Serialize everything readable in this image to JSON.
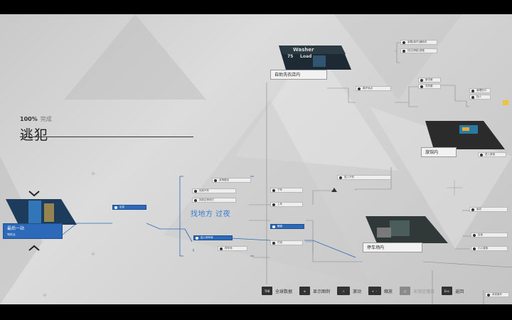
{
  "header": {
    "progress_pct": "100%",
    "progress_label": "完成",
    "chapter_title": "逃犯"
  },
  "scenes": {
    "laundromat": {
      "label": "自助洗衣店内",
      "thumb_text_1": "Washer",
      "thumb_text_2": "75",
      "thumb_text_3": "Load"
    },
    "motel": {
      "label": "旅馆内"
    },
    "parking": {
      "label": "停车场内"
    },
    "start": {
      "label": "最后一站",
      "sub": "铺新友"
    }
  },
  "center_label": "找地方 过夜",
  "nodes": {
    "n1": "拿着(离开)铺新衣",
    "n2": "找过(跨越)游路",
    "n3": "新衣服",
    "n4": "洗衣服",
    "n5": "清理伤口",
    "n6": "找人",
    "n7": "小心谨慎",
    "n8": "拿钱离开",
    "n9": "进入旅馆",
    "n10": "离开地点",
    "n11": "带走衣服",
    "n12": "进入汽车",
    "n13": "下车",
    "n14": "上车",
    "n15": "付钱",
    "n16": "偷窃",
    "n17": "结束",
    "n18": "游荡路径",
    "n19": "找到汽车",
    "n20": "找到过夜地方",
    "n21": "停车场",
    "n22": "出发",
    "n23": "进入停车场",
    "n24": "躲避",
    "n25": "找到地方"
  },
  "legend": {
    "tab_key": "TAB",
    "tab_label": "全球数据",
    "legend_key": "⊕",
    "legend_label": "显示图例",
    "move_key": "⊹",
    "move_label": "滚动",
    "zoom_key": "+ -",
    "zoom_label": "缩放",
    "locked_key": "□",
    "locked_label": "未锁定播放",
    "esc_key": "Esc",
    "esc_label": "返回"
  },
  "colors": {
    "accent_blue": "#2c69b8",
    "background": "#d2d2d2",
    "line_grey": "#8a8a8a"
  }
}
